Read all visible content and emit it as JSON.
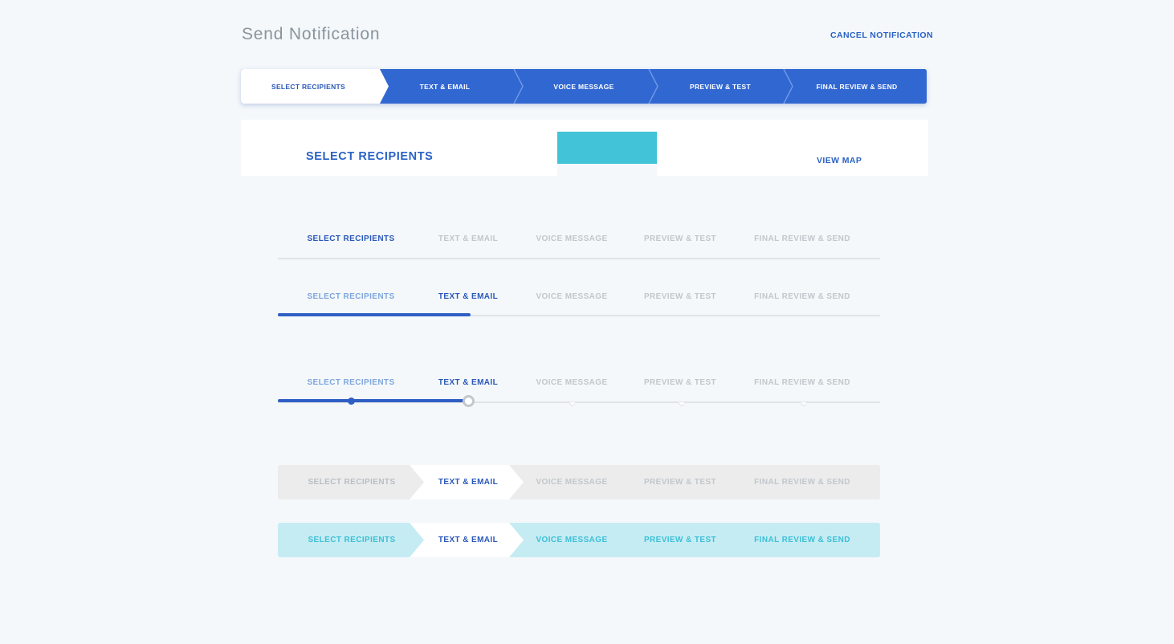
{
  "header": {
    "title": "Send Notification",
    "cancel_label": "CANCEL NOTIFICATION"
  },
  "steps": [
    "SELECT RECIPIENTS",
    "TEXT & EMAIL",
    "VOICE MESSAGE",
    "PREVIEW & TEST",
    "FINAL REVIEW & SEND"
  ],
  "card": {
    "title": "SELECT RECIPIENTS",
    "view_map_label": "VIEW MAP"
  },
  "variants": {
    "underline": {
      "current_step": 1
    },
    "progress_bar": {
      "current_step": 2,
      "progress": 0.32
    },
    "dots": {
      "current_step": 2,
      "progress": 0.32
    },
    "chevron_grey": {
      "current_step": 2
    },
    "chevron_teal": {
      "current_step": 2
    }
  },
  "colors": {
    "primary": "#3167d1",
    "active_text": "#2a58b8",
    "teal": "#43c3d8",
    "teal_light": "#c6ecf3",
    "grey_bar": "#ececec",
    "background": "#f4f8fb"
  }
}
